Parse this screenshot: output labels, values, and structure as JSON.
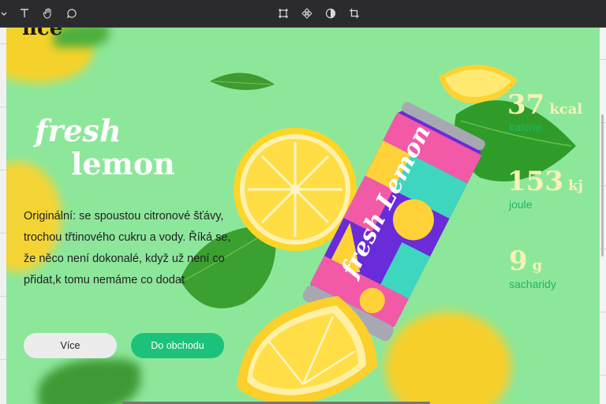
{
  "toolbar": {
    "left_tools": [
      "text-tool",
      "hand-tool",
      "comment-tool"
    ],
    "center_tools": [
      "frame-tool",
      "component-tool",
      "contrast-tool",
      "crop-tool"
    ]
  },
  "design": {
    "brand_text": "nce",
    "title_line1": "fresh",
    "title_line2": "lemon",
    "description": "Originální: se spoustou citronové šťávy, trochou třtinového cukru a vody. Říká se, že něco není dokonalé, když už není co přidat,k tomu nemáme co dodat",
    "buttons": {
      "more": "Více",
      "shop": "Do obchodu"
    },
    "can_label": "fresh Lemon",
    "stats": [
      {
        "value": "37",
        "unit": "kcal",
        "label": "kalorie"
      },
      {
        "value": "153",
        "unit": "kj",
        "label": "joule"
      },
      {
        "value": "9",
        "unit": "g",
        "label": "sacharidy"
      }
    ]
  },
  "colors": {
    "background": "#8de79b",
    "accent_green": "#1cc27a",
    "stat_value": "#f6f2b5",
    "stat_label": "#1fb46a"
  }
}
